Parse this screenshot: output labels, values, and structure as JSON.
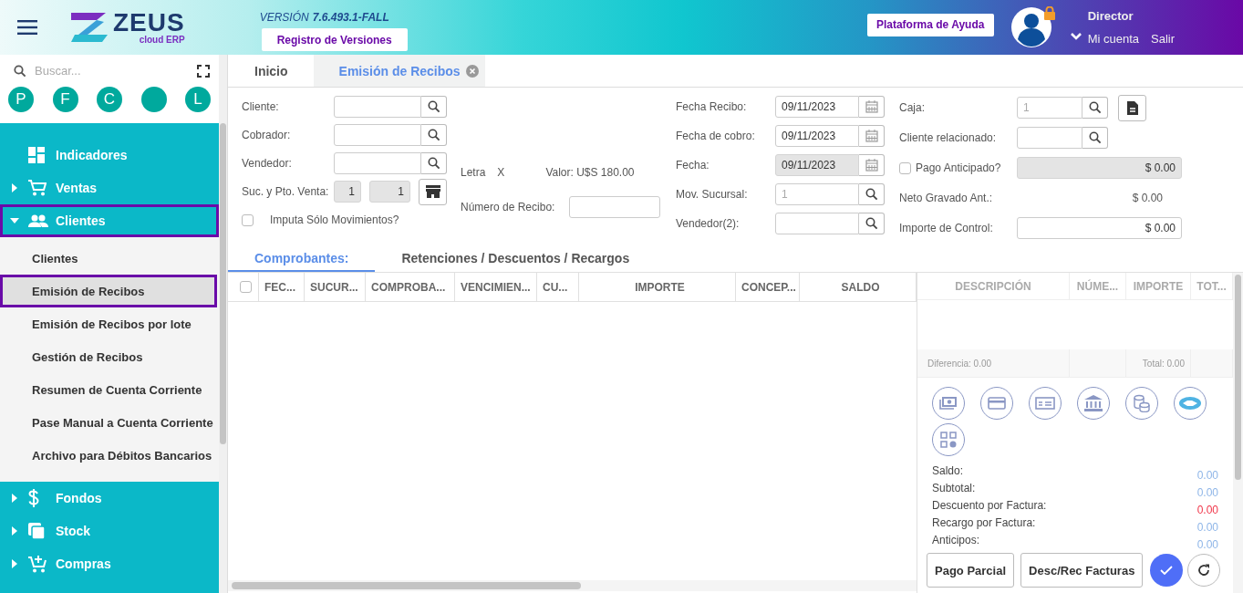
{
  "header": {
    "logo": {
      "name": "ZEUS",
      "tagline": "cloud ERP"
    },
    "version_label": "VERSIÓN",
    "version": "7.6.493.1-FALL",
    "versions_button": "Registro de Versiones",
    "help_button": "Plataforma de Ayuda",
    "user": {
      "role": "Director",
      "links": [
        "Mi cuenta",
        "Salir"
      ]
    }
  },
  "sidebar": {
    "search": {
      "placeholder": "Buscar..."
    },
    "shortcuts": [
      {
        "kind": "letter",
        "label": "P"
      },
      {
        "kind": "letter",
        "label": "F"
      },
      {
        "kind": "letter",
        "label": "C"
      },
      {
        "kind": "blank"
      },
      {
        "kind": "letter",
        "label": "L"
      }
    ],
    "menu": [
      {
        "label": "Indicadores",
        "selected": false
      },
      {
        "label": "Ventas",
        "expanded": false,
        "selected": false
      },
      {
        "label": "Clientes",
        "expanded": true,
        "selected": true,
        "children": [
          {
            "label": "Clientes",
            "selected": false
          },
          {
            "label": "Emisión de Recibos",
            "selected": true
          },
          {
            "label": "Emisión de Recibos por lote",
            "selected": false
          },
          {
            "label": "Gestión de Recibos",
            "selected": false
          },
          {
            "label": "Resumen de Cuenta Corriente",
            "selected": false
          },
          {
            "label": "Pase Manual a Cuenta Corriente",
            "selected": false
          },
          {
            "label": "Archivo para Débitos Bancarios",
            "selected": false
          }
        ]
      },
      {
        "label": "Fondos",
        "expanded": false,
        "selected": false
      },
      {
        "label": "Stock",
        "expanded": false,
        "selected": false
      },
      {
        "label": "Compras",
        "expanded": false,
        "selected": false
      }
    ]
  },
  "tabs": [
    {
      "label": "Inicio",
      "selected": false,
      "closable": false
    },
    {
      "label": "Emisión de Recibos",
      "selected": true,
      "closable": true
    }
  ],
  "form": {
    "left": [
      {
        "kind": "lookup",
        "label": "Cliente:"
      },
      {
        "kind": "lookup",
        "label": "Cobrador:"
      },
      {
        "kind": "lookup",
        "label": "Vendedor:"
      },
      {
        "kind": "pair",
        "label": "Suc. y Pto. Venta:",
        "values": [
          "1",
          "1"
        ]
      },
      {
        "kind": "checkbox",
        "label": "Imputa Sólo Movimientos?",
        "checked": false
      }
    ],
    "middle": {
      "letter": {
        "label": "Letra",
        "value": "X"
      },
      "amount": "Valor: U$S 180.00",
      "receipt_number": {
        "label": "Número de Recibo:"
      }
    },
    "dates": [
      {
        "kind": "date",
        "label": "Fecha Recibo:",
        "value": "09/11/2023",
        "disabled": false
      },
      {
        "kind": "date",
        "label": "Fecha de cobro:",
        "value": "09/11/2023",
        "disabled": false
      },
      {
        "kind": "date",
        "label": "Fecha:",
        "value": "09/11/2023",
        "disabled": true
      },
      {
        "kind": "lookup",
        "label": "Mov. Sucursal:",
        "placeholder": "1"
      },
      {
        "kind": "lookup",
        "label": "Vendedor(2):"
      }
    ],
    "right": [
      {
        "kind": "lookup-document",
        "label": "Caja:",
        "placeholder": "1"
      },
      {
        "kind": "lookup",
        "label": "Cliente relacionado:"
      },
      {
        "kind": "checkbox-amount",
        "label": "Pago Anticipado?",
        "checked": false,
        "value": "$ 0.00"
      },
      {
        "kind": "text",
        "label": "Neto Gravado Ant.:",
        "value": "$ 0.00"
      },
      {
        "kind": "amount",
        "label": "Importe de Control:",
        "value": "$ 0.00"
      }
    ]
  },
  "subtabs": [
    {
      "label": "Comprobantes:",
      "selected": true
    },
    {
      "label": "Retenciones / Descuentos / Recargos",
      "selected": false
    }
  ],
  "documents_table": {
    "select_all": {
      "checked": false
    },
    "columns": [
      "FEC...",
      "SUCUR...",
      "COMPROBA...",
      "VENCIMIEN...",
      "CU...",
      "IMPORTE",
      "CONCEP...",
      "SALDO"
    ]
  },
  "payments_table": {
    "columns": [
      "DESCRIPCIÓN",
      "NÚME...",
      "IMPORTE",
      "TOT..."
    ],
    "difference": "Diferencia: 0.00",
    "total": "Total: 0.00"
  },
  "totals": [
    {
      "label": "Saldo:",
      "value": "0.00",
      "color": "#8fb6e8"
    },
    {
      "label": "Subtotal:",
      "value": "0.00",
      "color": "#8fb6e8"
    },
    {
      "label": "Descuento por Factura:",
      "value": "0.00",
      "color": "#f0364a"
    },
    {
      "label": "Recargo por Factura:",
      "value": "0.00",
      "color": "#8fb6e8"
    },
    {
      "label": "Anticipos:",
      "value": "0.00",
      "color": "#8fb6e8"
    }
  ],
  "actions": [
    "Pago Parcial",
    "Desc/Rec Facturas"
  ]
}
